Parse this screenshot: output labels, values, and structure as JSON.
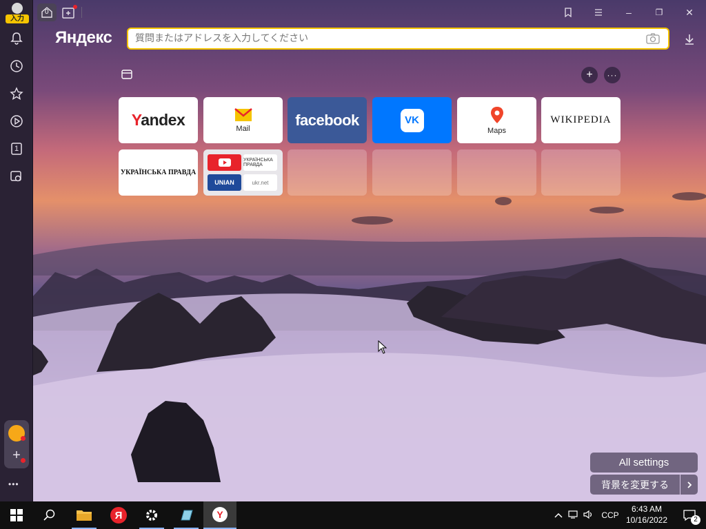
{
  "sidebar": {
    "avatar_badge": "入力",
    "items": [
      {
        "icon": "bell-icon"
      },
      {
        "icon": "clock-icon"
      },
      {
        "icon": "star-icon"
      },
      {
        "icon": "play-icon"
      },
      {
        "icon": "tab-count-icon",
        "label": "1"
      },
      {
        "icon": "screenshot-camera-icon"
      }
    ],
    "more_label": "•••"
  },
  "tabs": {
    "home_count": "0"
  },
  "window": {
    "bookmarks_icon": "bookmarks-icon",
    "menu_icon": "hamburger-icon",
    "minimize": "–",
    "restore": "❐",
    "close": "✕"
  },
  "header": {
    "logo": "Яндекс",
    "search_placeholder": "質問またはアドレスを入力してください"
  },
  "tiles": [
    {
      "id": "yandex",
      "label": "andex",
      "first_letter": "Y"
    },
    {
      "id": "mail",
      "label": "Mail"
    },
    {
      "id": "facebook",
      "label": "facebook"
    },
    {
      "id": "vk",
      "label": "VK"
    },
    {
      "id": "maps",
      "label": "Maps"
    },
    {
      "id": "wikipedia",
      "label": "WIKIPEDIA"
    },
    {
      "id": "pravda",
      "label": "УКРАЇНСЬКА ПРАВДА"
    },
    {
      "id": "group",
      "items": [
        "youtube",
        "УКРАЇНСЬКА ПРАВДА",
        "UNIAN",
        "ukr.net"
      ]
    }
  ],
  "actions": {
    "all_settings": "All settings",
    "change_background": "背景を変更する"
  },
  "taskbar": {
    "lang": "CCP",
    "time": "6:43 AM",
    "date": "10/16/2022",
    "notification_count": "2"
  },
  "colors": {
    "accent": "#f5c400",
    "facebook": "#3b5998",
    "vk": "#0077ff",
    "sidebar": "#2a2234"
  }
}
